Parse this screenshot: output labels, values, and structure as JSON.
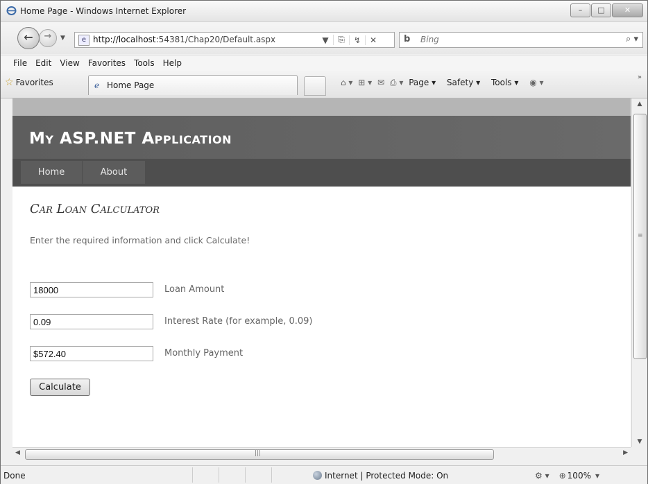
{
  "window": {
    "title": "Home Page - Windows Internet Explorer",
    "buttons": {
      "minimize": "–",
      "maximize": "□",
      "close": "✕"
    }
  },
  "toolbar": {
    "back_icon": "back-arrow-icon",
    "url_host": "http://localhost",
    "url_path": ":54381/Chap20/Default.aspx",
    "search_placeholder": "Bing"
  },
  "menubar": [
    "File",
    "Edit",
    "View",
    "Favorites",
    "Tools",
    "Help"
  ],
  "favbar": {
    "favorites_label": "Favorites",
    "tab_label": "Home Page",
    "commands": [
      "Page ▾",
      "Safety ▾",
      "Tools ▾"
    ]
  },
  "site": {
    "title": "My ASP.NET Application",
    "menu": [
      "Home",
      "About"
    ]
  },
  "page": {
    "heading": "Car Loan Calculator",
    "intro": "Enter the required information and click Calculate!",
    "fields": [
      {
        "value": "18000",
        "label": "Loan Amount"
      },
      {
        "value": "0.09",
        "label": "Interest Rate (for example, 0.09)"
      },
      {
        "value": "$572.40",
        "label": "Monthly Payment"
      }
    ],
    "button": "Calculate"
  },
  "statusbar": {
    "status": "Done",
    "zone": "Internet | Protected Mode: On",
    "zoom": "100%"
  }
}
